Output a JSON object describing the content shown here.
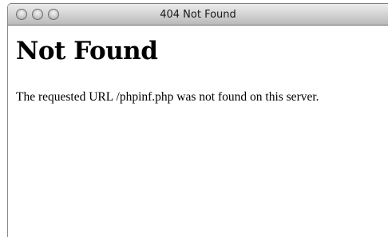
{
  "window": {
    "title": "404 Not Found"
  },
  "page": {
    "heading": "Not Found",
    "message": "The requested URL /phpinf.php was not found on this server."
  },
  "icons": {
    "close": "close-button-icon",
    "minimize": "minimize-button-icon",
    "zoom": "zoom-button-icon"
  },
  "colors": {
    "titlebar_top": "#ececec",
    "titlebar_bottom": "#b9b9b9",
    "text": "#000000",
    "background": "#ffffff"
  }
}
